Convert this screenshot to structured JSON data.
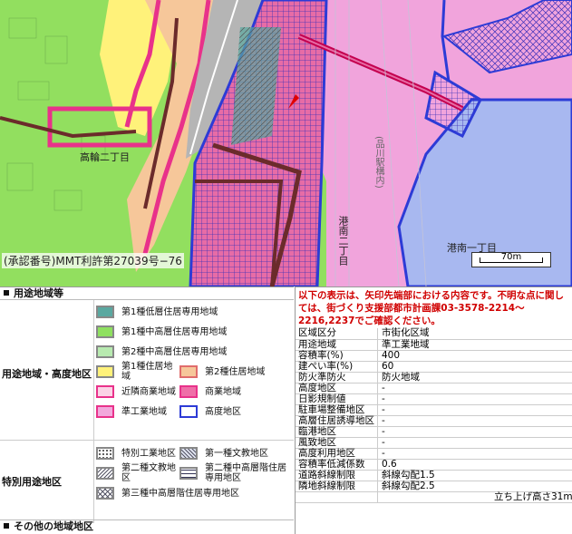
{
  "map": {
    "approval_text": "(承認番号)MMT利許第27039号−76",
    "scale_label": "70m",
    "place_labels": [
      "高輪二丁目",
      "港南一丁目",
      "港南二丁目",
      "(品川駅構内)"
    ]
  },
  "legend": {
    "section1_title": "用途地域等",
    "group_zoning": "用途地域・高度地区",
    "group_special": "特別用途地区",
    "section2_title": "その他の地域地区",
    "items": [
      {
        "label": "第1種低層住居専用地域",
        "color": "#5aa8a0"
      },
      {
        "label": "第1種中高層住居専用地域",
        "color": "#8fe060"
      },
      {
        "label": "第2種中高層住居専用地域",
        "color": "#b8eab0"
      },
      {
        "label": "第1種住居地域",
        "color": "#fff27a"
      },
      {
        "label": "第2種住居地域",
        "color": "#f6c79a"
      },
      {
        "label": "近隣商業地域",
        "color": "#fbd3e6"
      },
      {
        "label": "商業地域",
        "color": "#ef6fa8"
      },
      {
        "label": "準工業地域",
        "color": "#f2a8dc"
      },
      {
        "label": "高度地区",
        "color": "#ffffff"
      },
      {
        "label": "特別工業地区",
        "color": "dots"
      },
      {
        "label": "第一種文教地区",
        "color": "diag"
      },
      {
        "label": "第二種文教地区",
        "color": "diag2"
      },
      {
        "label": "第二種中高層階住居専用地区",
        "color": "grid"
      },
      {
        "label": "第三種中高層階住居専用地区",
        "color": "cross"
      }
    ]
  },
  "info": {
    "notice": "以下の表示は、矢印先端部における内容です。不明な点に関しては、街づくり支援部都市計画課03-3578-2214〜2216,2237でご確認ください。",
    "rows": [
      {
        "k": "区域区分",
        "v": "市街化区域"
      },
      {
        "k": "用途地域",
        "v": "準工業地域"
      },
      {
        "k": "容積率(%)",
        "v": "400"
      },
      {
        "k": "建ぺい率(%)",
        "v": "60"
      },
      {
        "k": "防火準防火",
        "v": "防火地域"
      },
      {
        "k": "高度地区",
        "v": "-"
      },
      {
        "k": "日影規制値",
        "v": "-"
      },
      {
        "k": "駐車場整備地区",
        "v": "-"
      },
      {
        "k": "高層住居誘導地区",
        "v": "-"
      },
      {
        "k": "臨港地区",
        "v": "-"
      },
      {
        "k": "風致地区",
        "v": "-"
      },
      {
        "k": "高度利用地区",
        "v": "-"
      },
      {
        "k": "容積率低減係数",
        "v": "0.6"
      },
      {
        "k": "道路斜線制限",
        "v": "斜線勾配1.5"
      },
      {
        "k": "隣地斜線制限",
        "v": "斜線勾配2.5"
      },
      {
        "k": "",
        "v": "立ち上げ高さ31m"
      }
    ]
  }
}
